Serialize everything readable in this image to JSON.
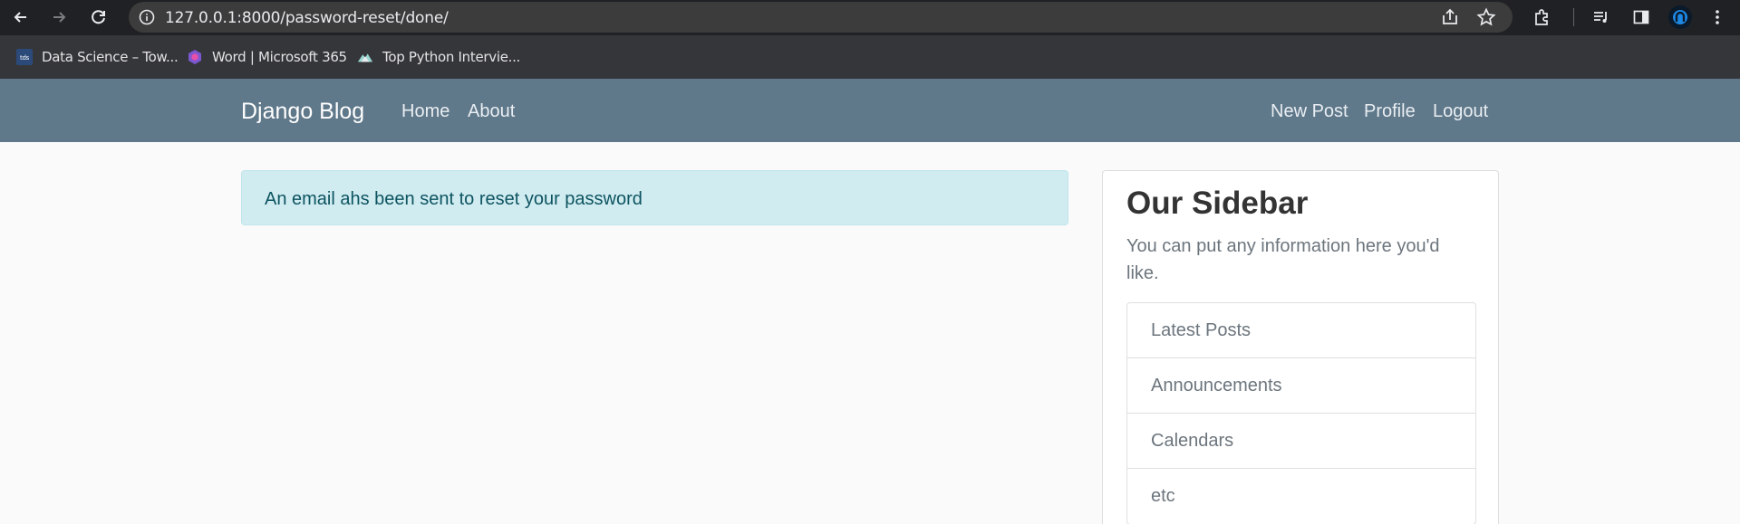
{
  "browser": {
    "url": "127.0.0.1:8000/password-reset/done/",
    "bookmarks": [
      {
        "icon": "tds-icon",
        "label": "Data Science – Tow..."
      },
      {
        "icon": "microsoft365-icon",
        "label": "Word | Microsoft 365"
      },
      {
        "icon": "python-mountain-icon",
        "label": "Top Python Intervie..."
      }
    ],
    "colors": {
      "toolbar": "#202124",
      "bookmarks_bar": "#35363a",
      "omnibox": "#3c3c3c"
    }
  },
  "navbar": {
    "brand": "Django Blog",
    "left_links": [
      "Home",
      "About"
    ],
    "right_links": [
      "New Post",
      "Profile",
      "Logout"
    ],
    "color": "#5f788a"
  },
  "alert": {
    "message": "An email ahs been sent to reset your password",
    "type": "info"
  },
  "sidebar": {
    "title": "Our Sidebar",
    "text": "You can put any information here you'd like.",
    "items": [
      "Latest Posts",
      "Announcements",
      "Calendars",
      "etc"
    ]
  }
}
